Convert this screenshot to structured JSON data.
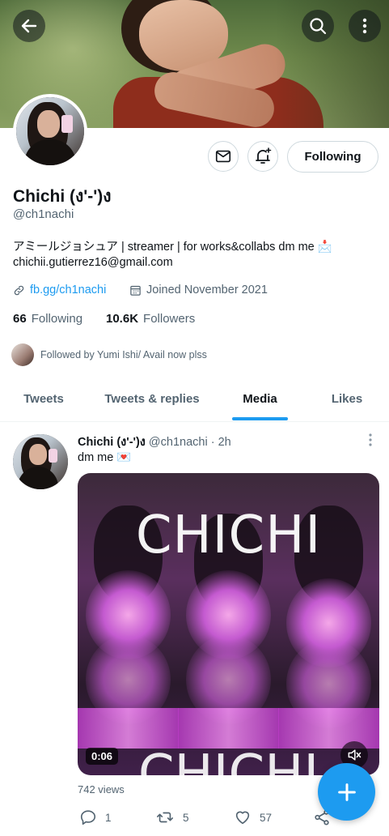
{
  "header": {
    "back_icon": "arrow-left-icon",
    "search_icon": "search-icon",
    "more_icon": "more-vertical-icon"
  },
  "profile": {
    "name": "Chichi (ง'-')ง",
    "handle": "@ch1nachi",
    "bio_line1": "アミールジョシュア | streamer | for works&collabs dm me 📩",
    "bio_line2": "chichii.gutierrez16@gmail.com",
    "link": "fb.gg/ch1nachi",
    "joined": "Joined November 2021",
    "following_count": "66",
    "following_label": "Following",
    "followers_count": "10.6K",
    "followers_label": "Followers",
    "followed_by": "Followed by Yumi Ishi/ Avail now plss",
    "follow_button": "Following"
  },
  "tabs": [
    {
      "label": "Tweets"
    },
    {
      "label": "Tweets & replies"
    },
    {
      "label": "Media"
    },
    {
      "label": "Likes"
    }
  ],
  "active_tab": "Media",
  "tweet": {
    "name": "Chichi (ง'-')ง",
    "handle": "@ch1nachi",
    "time": "· 2h",
    "text": "dm me 💌",
    "media_text": "CHICHI",
    "duration": "0:06",
    "views": "742 views",
    "replies": "1",
    "retweets": "5",
    "likes": "57"
  },
  "colors": {
    "accent": "#1d9bf0",
    "text": "#0f1419",
    "muted": "#536471",
    "border": "#cfd9de"
  }
}
